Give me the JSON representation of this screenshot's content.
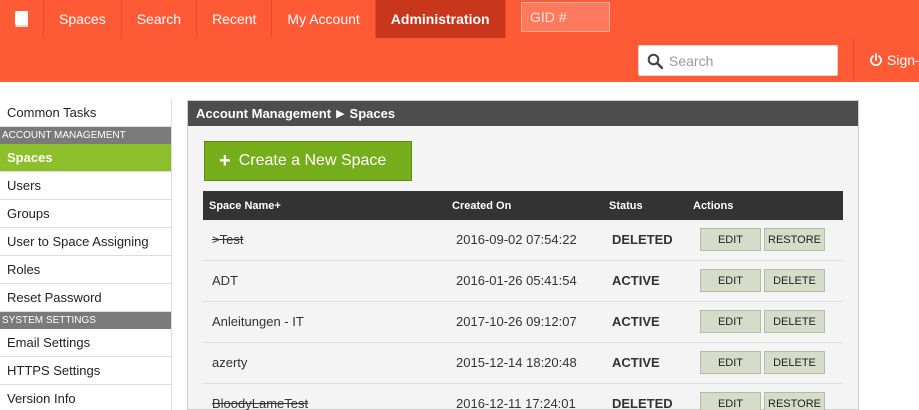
{
  "nav": {
    "items": [
      {
        "label": "Spaces",
        "active": false
      },
      {
        "label": "Search",
        "active": false
      },
      {
        "label": "Recent",
        "active": false
      },
      {
        "label": "My Account",
        "active": false
      },
      {
        "label": "Administration",
        "active": true
      }
    ],
    "gid_placeholder": "GID #",
    "logo_icon": "book-icon"
  },
  "search": {
    "placeholder": "Search",
    "icon": "search-icon"
  },
  "signout": {
    "label": "Sign-",
    "icon": "power-icon"
  },
  "sidebar": {
    "top_item": "Common Tasks",
    "sections": [
      {
        "title": "ACCOUNT MANAGEMENT",
        "items": [
          "Spaces",
          "Users",
          "Groups",
          "User to Space Assigning",
          "Roles",
          "Reset Password"
        ]
      },
      {
        "title": "SYSTEM SETTINGS",
        "items": [
          "Email Settings",
          "HTTPS Settings",
          "Version Info"
        ]
      }
    ],
    "active_item": "Spaces"
  },
  "panel": {
    "breadcrumb": [
      "Account Management",
      "Spaces"
    ],
    "breadcrumb_sep": "▶",
    "create_button": "Create a New Space",
    "columns": [
      "Space Name+",
      "Created On",
      "Status",
      "Actions"
    ],
    "rows": [
      {
        "name": ">Test",
        "created": "2016-09-02 07:54:22",
        "status": "DELETED",
        "actions": [
          "EDIT",
          "RESTORE"
        ]
      },
      {
        "name": "ADT",
        "created": "2016-01-26 05:41:54",
        "status": "ACTIVE",
        "actions": [
          "EDIT",
          "DELETE"
        ]
      },
      {
        "name": "Anleitungen - IT",
        "created": "2017-10-26 09:12:07",
        "status": "ACTIVE",
        "actions": [
          "EDIT",
          "DELETE"
        ]
      },
      {
        "name": "azerty",
        "created": "2015-12-14 18:20:48",
        "status": "ACTIVE",
        "actions": [
          "EDIT",
          "DELETE"
        ]
      },
      {
        "name": "BloodyLameTest",
        "created": "2016-12-11 17:24:01",
        "status": "DELETED",
        "actions": [
          "EDIT",
          "RESTORE"
        ]
      }
    ]
  },
  "colors": {
    "brand": "#ff5a36",
    "nav_active": "#c8361c",
    "accent_green": "#76ad1a",
    "sidebar_active": "#8cbf2a"
  }
}
